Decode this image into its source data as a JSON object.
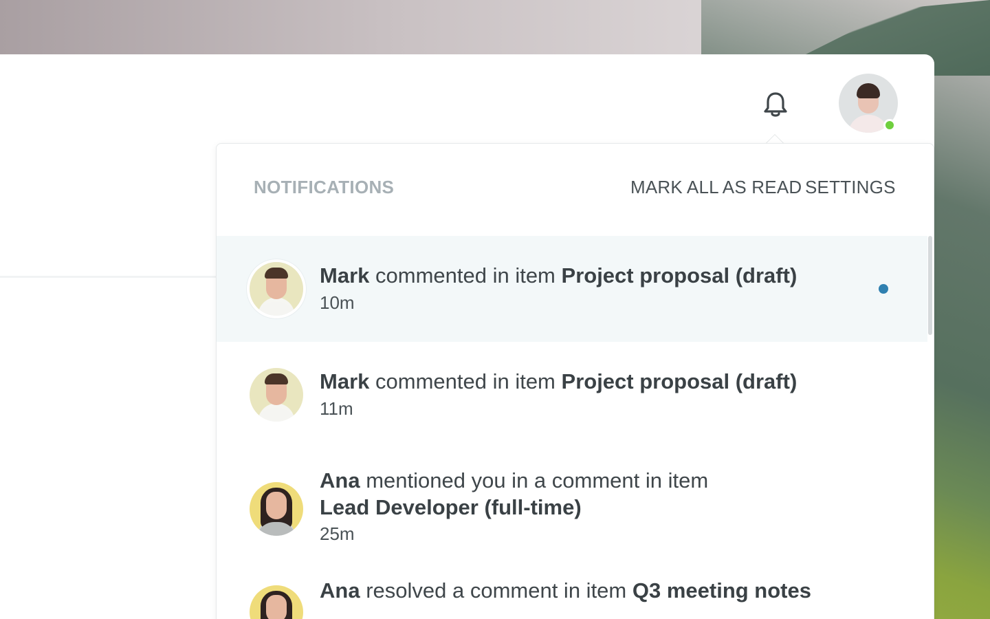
{
  "popover": {
    "title": "NOTIFICATIONS",
    "mark_all_label": "MARK ALL AS READ",
    "settings_label": "SETTINGS"
  },
  "colors": {
    "unread_bg": "#f3f8f9",
    "unread_dot": "#2f80b0",
    "presence": "#6fcf3d",
    "title_muted": "#a7b0b5"
  },
  "icons": {
    "bell": "bell-icon",
    "presence": "online-status-dot"
  },
  "notifications": [
    {
      "actor": "Mark",
      "action": "commented in item",
      "target": "Project proposal (draft)",
      "time": "10m",
      "unread": true
    },
    {
      "actor": "Mark",
      "action": "commented in item",
      "target": "Project proposal (draft)",
      "time": "11m",
      "unread": false
    },
    {
      "actor": "Ana",
      "action": "mentioned you in a comment in item",
      "target": "Lead Developer (full-time)",
      "time": "25m",
      "unread": false
    },
    {
      "actor": "Ana",
      "action": "resolved a comment in item",
      "target": "Q3 meeting notes",
      "time": "",
      "unread": false
    }
  ]
}
